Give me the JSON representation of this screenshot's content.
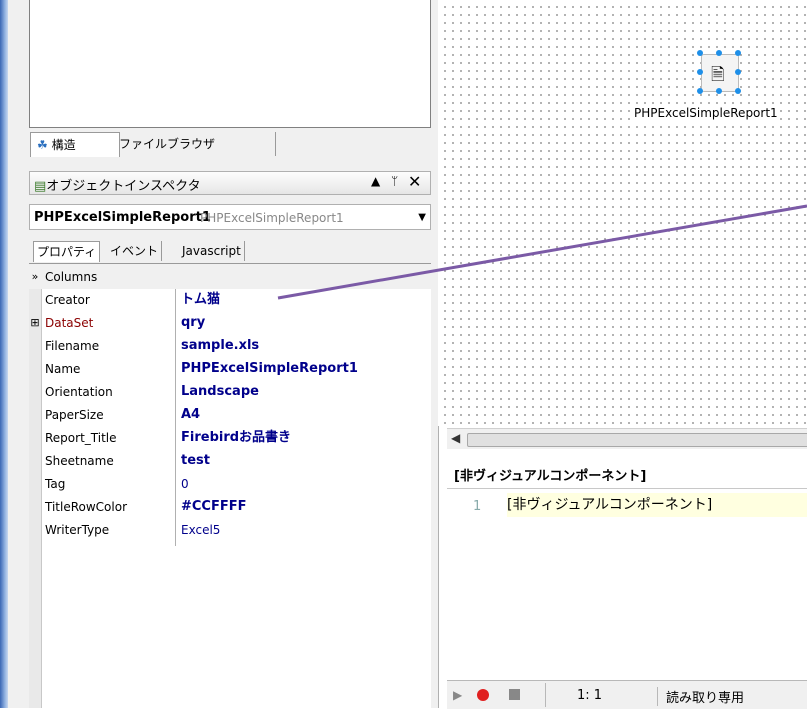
{
  "left_panel": {
    "tabs": [
      {
        "label": "構造"
      },
      {
        "label": "ファイルブラウザ"
      }
    ],
    "inspector_title": "オブジェクトインスペクタ",
    "inspector_controls": {
      "dropdown": "▲",
      "pin": "ᛘ",
      "close": "✕"
    },
    "selected_component": {
      "name": "PHPExcelSimpleReport1",
      "class": "PHPExcelSimpleReport1"
    },
    "subtabs": [
      "プロパティ",
      "イベント",
      "Javascript"
    ],
    "properties": [
      {
        "name": "Columns",
        "value": "",
        "marker": "»",
        "color": "#000000"
      },
      {
        "name": "Creator",
        "value": "トム猫",
        "marker": "",
        "color": "#000000"
      },
      {
        "name": "DataSet",
        "value": "qry",
        "marker": "⊞",
        "color": "#8b0000"
      },
      {
        "name": "Filename",
        "value": "sample.xls",
        "marker": "",
        "color": "#000000"
      },
      {
        "name": "Name",
        "value": "PHPExcelSimpleReport1",
        "marker": "",
        "color": "#000000"
      },
      {
        "name": "Orientation",
        "value": "Landscape",
        "marker": "",
        "color": "#000000"
      },
      {
        "name": "PaperSize",
        "value": "A4",
        "marker": "",
        "color": "#000000"
      },
      {
        "name": "Report_Title",
        "value": "Firebirdお品書き",
        "marker": "",
        "color": "#000000"
      },
      {
        "name": "Sheetname",
        "value": "test",
        "marker": "",
        "color": "#000000"
      },
      {
        "name": "Tag",
        "value": "0",
        "marker": "",
        "color": "#000000",
        "plain": true
      },
      {
        "name": "TitleRowColor",
        "value": "#CCFFFF",
        "marker": "",
        "color": "#000000"
      },
      {
        "name": "WriterType",
        "value": "Excel5",
        "marker": "",
        "color": "#000000",
        "plain": true
      }
    ]
  },
  "designer": {
    "component_label": "PHPExcelSimpleReport1",
    "component_icon": "report-icon"
  },
  "editor": {
    "header": "[非ヴィジュアルコンポーネント]",
    "line_number": "1",
    "code": "[非ヴィジュアルコンポーネント]"
  },
  "statusbar": {
    "position": "1: 1",
    "mode": "読み取り専用"
  },
  "colors": {
    "value_text": "#00008b",
    "selection_handle": "#1e8fe8",
    "annotation_arrow": "#7b5aa6"
  }
}
